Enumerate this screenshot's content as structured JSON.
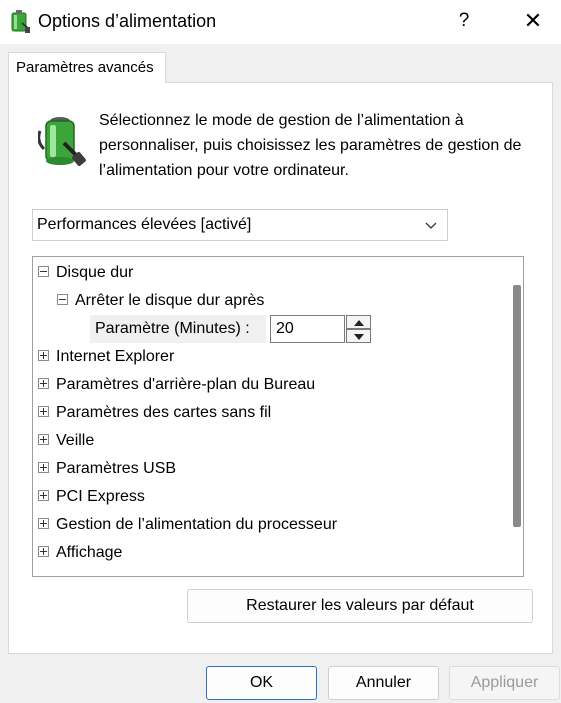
{
  "window": {
    "title": "Options d’alimentation",
    "help_glyph": "?",
    "close_glyph": "✕"
  },
  "tabs": [
    {
      "label": "Paramètres avancés"
    }
  ],
  "description": "Sélectionnez le mode de gestion de l’alimentation à personnaliser, puis choisissez les paramètres de gestion de l’alimentation pour votre ordinateur.",
  "plan_select": {
    "selected": "Performances élevées [activé]"
  },
  "tree": {
    "items": [
      {
        "label": "Disque dur",
        "expanded": true
      },
      {
        "label": "Arrêter le disque dur après",
        "expanded": true
      },
      {
        "label": "Internet Explorer",
        "expanded": false
      },
      {
        "label": "Paramètres d'arrière-plan du Bureau",
        "expanded": false
      },
      {
        "label": "Paramètres des cartes sans fil",
        "expanded": false
      },
      {
        "label": "Veille",
        "expanded": false
      },
      {
        "label": "Paramètres USB",
        "expanded": false
      },
      {
        "label": "PCI Express",
        "expanded": false
      },
      {
        "label": "Gestion de l’alimentation du processeur",
        "expanded": false
      },
      {
        "label": "Affichage",
        "expanded": false
      }
    ],
    "setting": {
      "label": "Paramètre (Minutes) :",
      "value": "20"
    }
  },
  "buttons": {
    "restore": "Restaurer les valeurs par défaut",
    "ok": "OK",
    "cancel": "Annuler",
    "apply": "Appliquer"
  },
  "icons": {
    "app": "battery-plug-icon",
    "description": "battery-plug-icon",
    "help": "help-icon",
    "close": "close-icon",
    "dropdown": "chevron-down-icon",
    "spin_up": "spin-up-icon",
    "spin_down": "spin-down-icon"
  },
  "colors": {
    "accent": "#2f6fc8",
    "battery_green": "#3aa63a",
    "window_bg": "#f0f0f0"
  }
}
